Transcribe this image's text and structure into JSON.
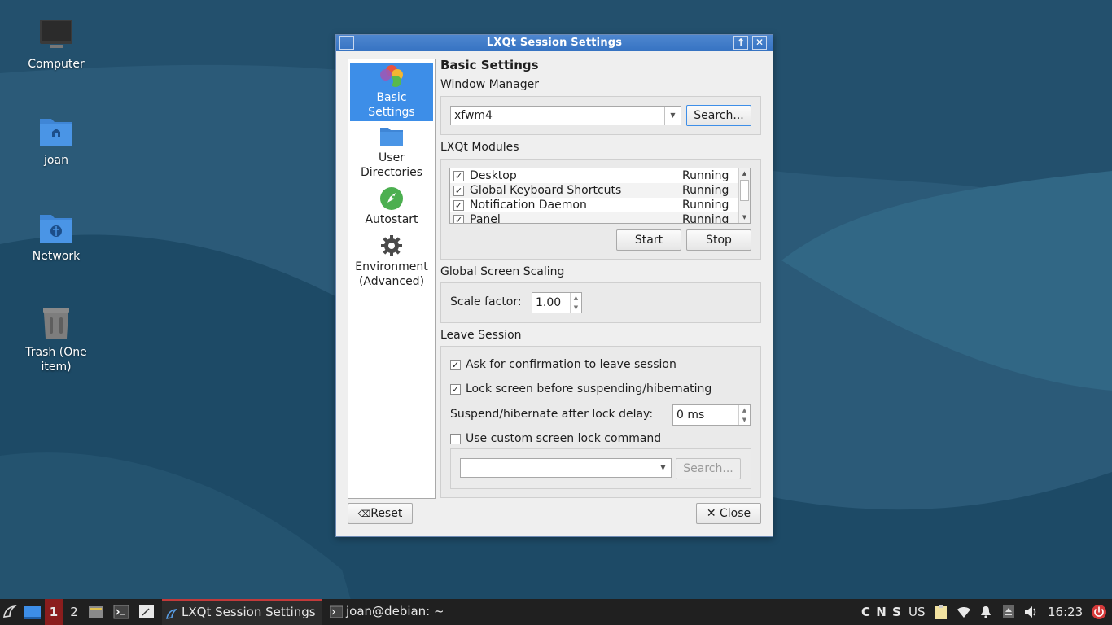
{
  "desktop": {
    "icons": [
      {
        "label": "Computer"
      },
      {
        "label": "joan"
      },
      {
        "label": "Network"
      },
      {
        "label": "Trash (One item)"
      }
    ]
  },
  "window": {
    "title": "LXQt Session Settings",
    "titlebar_buttons": {
      "maximize": "↑",
      "close": "✕"
    },
    "sidebar": [
      {
        "label": "Basic Settings",
        "icon": "color-petals-icon",
        "active": true
      },
      {
        "label": "User Directories",
        "icon": "folder-icon",
        "active": false
      },
      {
        "label": "Autostart",
        "icon": "rocket-icon",
        "active": false
      },
      {
        "label": "Environment (Advanced)",
        "icon": "gear-icon",
        "active": false
      }
    ],
    "page_title": "Basic Settings",
    "window_manager": {
      "label": "Window Manager",
      "value": "xfwm4",
      "search_button": "Search..."
    },
    "modules": {
      "label": "LXQt Modules",
      "rows": [
        {
          "name": "Desktop",
          "status": "Running",
          "checked": true
        },
        {
          "name": "Global Keyboard Shortcuts",
          "status": "Running",
          "checked": true
        },
        {
          "name": "Notification Daemon",
          "status": "Running",
          "checked": true
        },
        {
          "name": "Panel",
          "status": "Running",
          "checked": true
        }
      ],
      "start_button": "Start",
      "stop_button": "Stop"
    },
    "scaling": {
      "label": "Global Screen Scaling",
      "scale_label": "Scale factor:",
      "scale_value": "1.00"
    },
    "leave": {
      "label": "Leave Session",
      "confirm_label": "Ask for confirmation to leave session",
      "confirm_checked": true,
      "lock_label": "Lock screen before suspending/hibernating",
      "lock_checked": true,
      "delay_label": "Suspend/hibernate after lock delay:",
      "delay_value": "0 ms",
      "custom_label": "Use custom screen lock command",
      "custom_checked": false,
      "custom_value": "",
      "custom_search": "Search..."
    },
    "reset_button": "Reset",
    "close_button": "Close"
  },
  "taskbar": {
    "workspaces": [
      "1",
      "2"
    ],
    "tasks": [
      {
        "label": "LXQt Session Settings",
        "active": true
      },
      {
        "label": "joan@debian: ~",
        "active": false
      }
    ],
    "keyboard_indicators": "C N S",
    "layout": "US",
    "clock": "16:23"
  }
}
